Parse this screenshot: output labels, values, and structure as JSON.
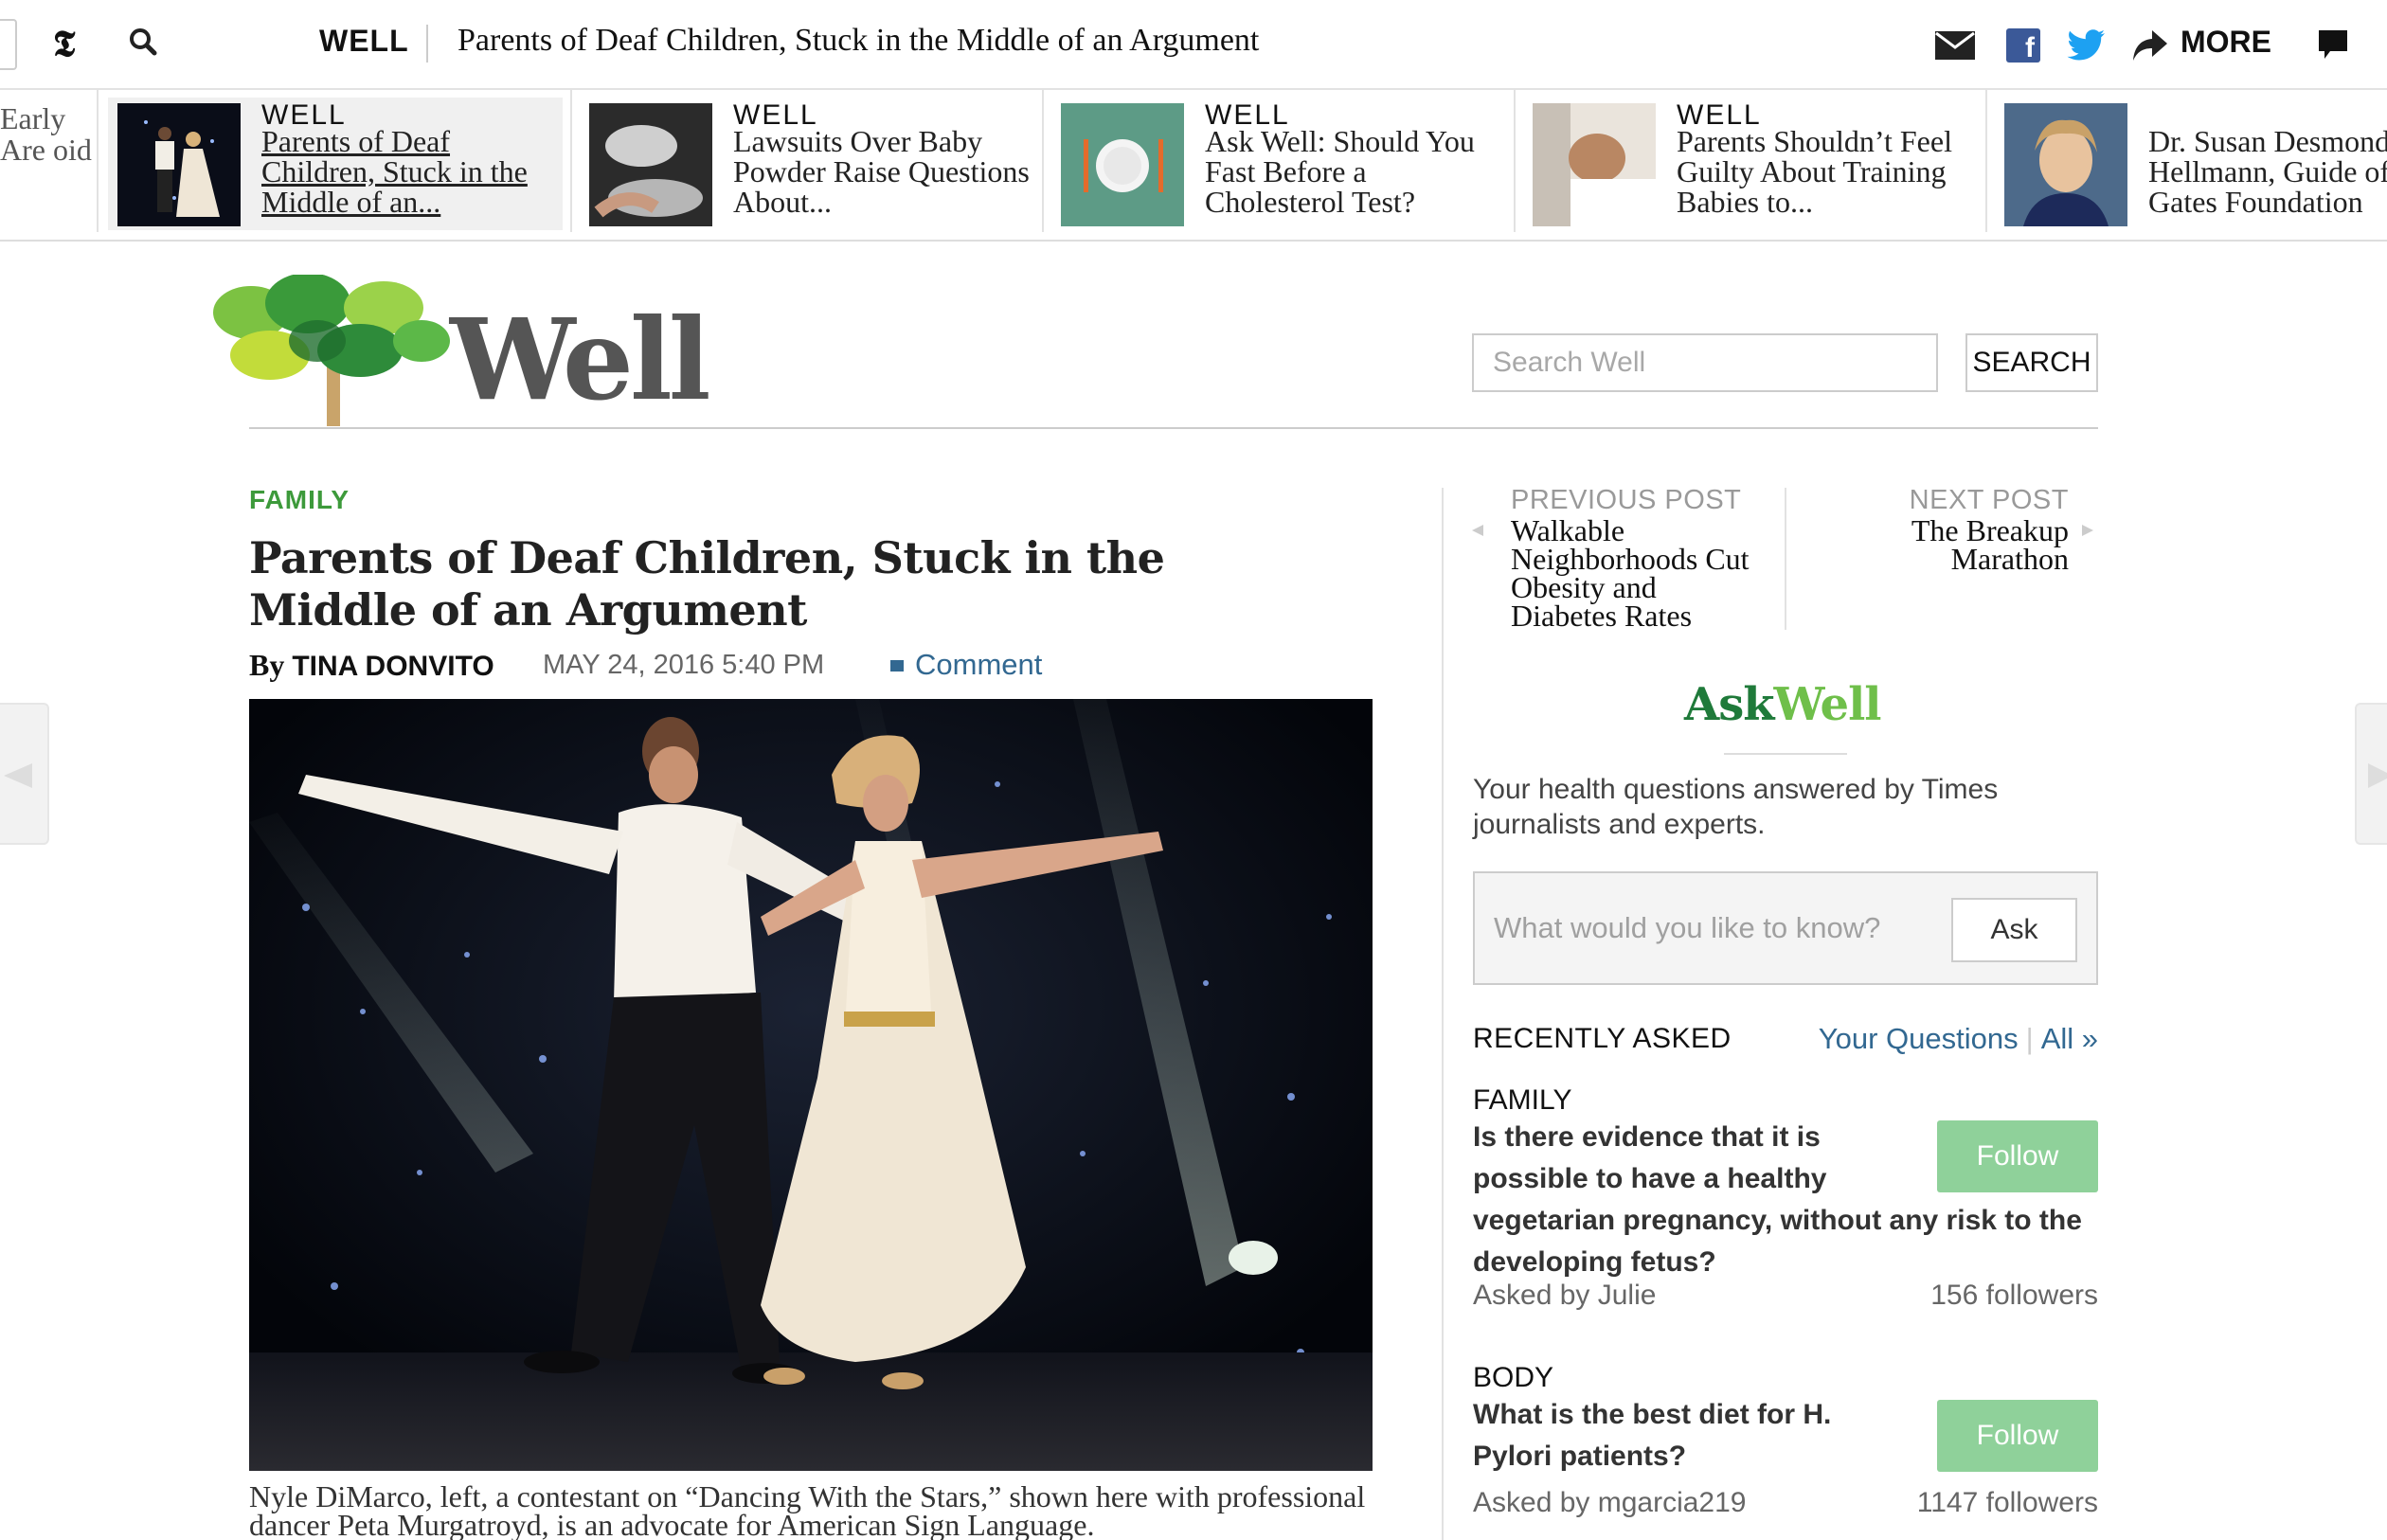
{
  "topbar": {
    "logo_glyph": "𝕿",
    "section": "WELL",
    "title": "Parents of Deaf Children, Stuck in the Middle of an Argument",
    "more_label": "MORE"
  },
  "ribbon": {
    "partial_text": "Early Are oid",
    "items": [
      {
        "kicker": "WELL",
        "headline": "Parents of Deaf Children, Stuck in the Middle of an..."
      },
      {
        "kicker": "WELL",
        "headline": "Lawsuits Over Baby Powder Raise Questions About..."
      },
      {
        "kicker": "WELL",
        "headline": "Ask Well: Should You Fast Before a Cholesterol Test?"
      },
      {
        "kicker": "WELL",
        "headline": "Parents Shouldn’t Feel Guilty About Training Babies to..."
      },
      {
        "kicker": "",
        "headline": "Dr. Susan Desmond-Hellmann, Guide of the Gates Foundation"
      }
    ]
  },
  "masthead": {
    "logo_word": "Well",
    "search_placeholder": "Search Well",
    "search_button": "SEARCH"
  },
  "article": {
    "kicker": "FAMILY",
    "headline": "Parents of Deaf Children, Stuck in the Middle of an Argument",
    "by": "By",
    "author": "TINA DONVITO",
    "date": "MAY 24, 2016 5:40 PM",
    "comment_label": "Comment",
    "caption": "Nyle DiMarco, left, a contestant on “Dancing With the Stars,” shown here with professional dancer Peta Murgatroyd, is an advocate for American Sign Language."
  },
  "post_nav": {
    "previous_label": "PREVIOUS POST",
    "previous_title": "Walkable Neighborhoods Cut Obesity and Diabetes Rates",
    "next_label": "NEXT POST",
    "next_title": "The Breakup Marathon"
  },
  "askwell": {
    "logo_ask": "Ask",
    "logo_well": "Well",
    "description": "Your health questions answered by Times journalists and experts.",
    "input_placeholder": "What would you like to know?",
    "ask_button": "Ask",
    "recently_asked_label": "RECENTLY ASKED",
    "your_questions_link": "Your Questions",
    "all_link": "All »",
    "questions": [
      {
        "category": "FAMILY",
        "question": "Is there evidence that it is possible to have a healthy vegetarian pregnancy, without any risk to the developing fetus?",
        "follow": "Follow",
        "asked_by": "Asked by Julie",
        "followers": "156 followers"
      },
      {
        "category": "BODY",
        "question": "What is the best diet for H. Pylori patients?",
        "follow": "Follow",
        "asked_by": "Asked by mgarcia219",
        "followers": "1147 followers"
      }
    ]
  },
  "colors": {
    "link_blue": "#326891",
    "family_green": "#3d9a3b",
    "follow_green": "#8fd19a",
    "askwell_dark_green": "#1f7a3a",
    "askwell_light_green": "#6fbf4a"
  },
  "icons": [
    "nyt-logo-icon",
    "search-icon",
    "mail-icon",
    "facebook-icon",
    "twitter-icon",
    "share-arrow-icon",
    "comment-icon",
    "previous-arrow-icon",
    "next-arrow-icon"
  ]
}
